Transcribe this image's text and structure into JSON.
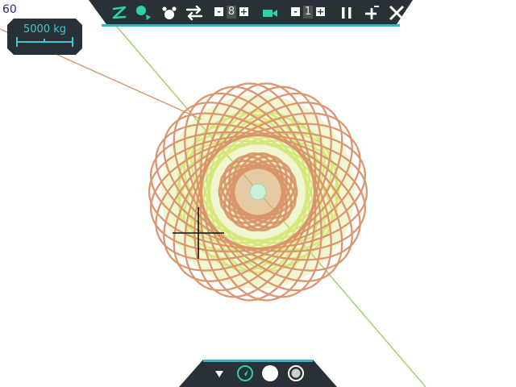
{
  "hud": {
    "fps": "60",
    "scale_label": "5000 kg"
  },
  "toolbar": {
    "icons": [
      "trail-icon",
      "add-body-icon",
      "collide-icon",
      "swap-icon",
      "speed-stepper",
      "camera-icon",
      "zoom-stepper",
      "pause-icon",
      "add-remove-icon",
      "close-icon"
    ],
    "speed_value": "8",
    "zoom_value": "1",
    "minus_label": "-",
    "plus_label": "+"
  },
  "bottom_bar": {
    "icons": [
      "collapse-icon",
      "orbit-target-icon",
      "solid-body-icon",
      "ring-body-icon"
    ]
  },
  "colors": {
    "panel": "#283236",
    "accent": "#35b3c8",
    "green_icon": "#2fd0a4",
    "orbit_orange": "#d9946a",
    "orbit_yellow": "#d6e67a",
    "trajectory_green": "#9ccc65"
  }
}
